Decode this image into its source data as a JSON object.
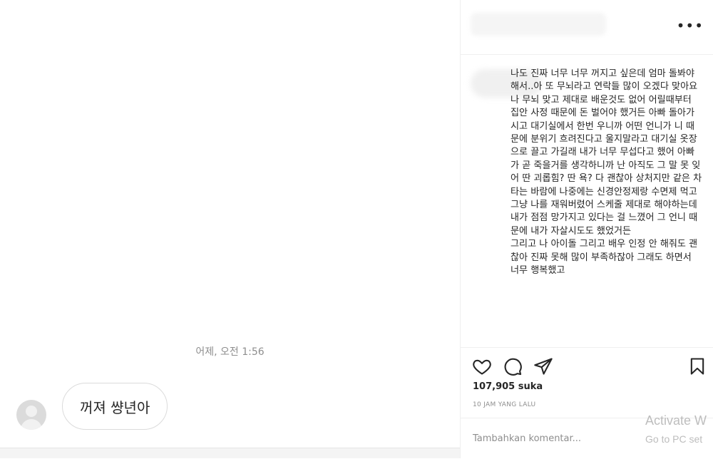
{
  "chat": {
    "timestamp": "어제, 오전 1:56",
    "message": "꺼져 썅년아"
  },
  "post": {
    "caption": "나도 진짜 너무 너무 꺼지고 싶은데 엄마 돌봐야해서..아 또 무뇌라고 연락들 많이 오겠다 맞아요 나 무뇌 맞고 제대로 배운것도 없어 어릴때부터 집안 사정 때문에 돈 벌어야 했거든 아빠 돌아가시고 대기실에서 한번 우니까 어떤 언니가 니 때문에 분위기 흐려진다고 울지말라고 대기실 옷장으로 끌고 가길래 내가 너무 무섭다고 했어 아빠가 곧 죽을거를 생각하니까 난 아직도 그 말 못 잊어 딴 괴롭힘? 딴 욕? 다 괜찮아 상처지만 같은 차 타는 바람에 나중에는 신경안정제랑 수면제 먹고 그냥 나를 재워버렸어 스케줄 제대로 해야하는데 내가 점점 망가지고 있다는 걸 느꼈어 그 언니 때문에 내가 자살시도도 했었거든\n그리고 나 아이돌 그리고 배우 인정 안 해줘도 괜찮아 진짜 못해 많이 부족하잖아 그래도 하면서 너무 행복했고",
    "likes": "107,905 suka",
    "time_ago": "10 JAM YANG LALU",
    "comment_placeholder": "Tambahkan komentar...",
    "more_label": "•••"
  },
  "watermark": {
    "line1": "Activate W",
    "line2": "Go to PC set"
  },
  "icons": [
    "heart-icon",
    "comment-icon",
    "share-icon",
    "bookmark-icon",
    "more-icon",
    "avatar-placeholder-icon"
  ]
}
